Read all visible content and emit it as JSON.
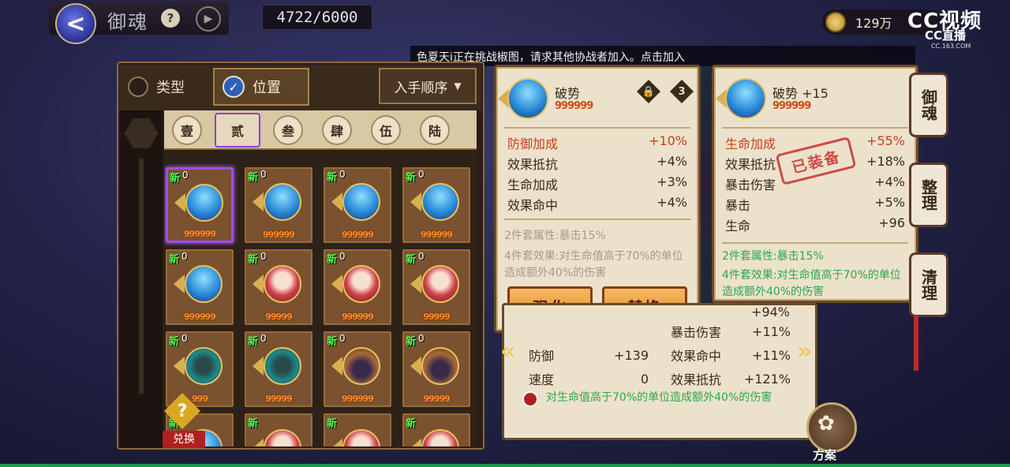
{
  "header": {
    "title": "御魂",
    "help_icon": "?",
    "back_icon": "<",
    "play_icon": "▶",
    "capacity": "4722/6000",
    "currency": "129万",
    "watermark_main": "CC视频",
    "watermark_sub": "CC直播",
    "watermark_url": "CC.163.COM"
  },
  "marquee": "色夏天i正在挑战椒图，请求其他协战者加入。点击加入",
  "filters": {
    "type_label": "类型",
    "position_label": "位置",
    "position_checked": true,
    "sort_label": "入手顺序",
    "sort_caret": "▼"
  },
  "slots": [
    "壹",
    "贰",
    "叁",
    "肆",
    "伍",
    "陆"
  ],
  "active_slot": 1,
  "grid": {
    "new_label": "新",
    "cards": [
      {
        "level": "0",
        "stars": "999999",
        "kind": "blue",
        "selected": true
      },
      {
        "level": "0",
        "stars": "999999",
        "kind": "blue"
      },
      {
        "level": "0",
        "stars": "999999",
        "kind": "blue"
      },
      {
        "level": "0",
        "stars": "999999",
        "kind": "blue"
      },
      {
        "level": "0",
        "stars": "999999",
        "kind": "blue"
      },
      {
        "level": "0",
        "stars": "99999",
        "kind": "red"
      },
      {
        "level": "0",
        "stars": "999999",
        "kind": "red"
      },
      {
        "level": "0",
        "stars": "99999",
        "kind": "red"
      },
      {
        "level": "0",
        "stars": "999",
        "kind": "teal"
      },
      {
        "level": "0",
        "stars": "99999",
        "kind": "teal"
      },
      {
        "level": "0",
        "stars": "999999",
        "kind": "straw"
      },
      {
        "level": "0",
        "stars": "99999",
        "kind": "straw"
      },
      {
        "level": "",
        "stars": "",
        "kind": "blue"
      },
      {
        "level": "",
        "stars": "",
        "kind": "red"
      },
      {
        "level": "",
        "stars": "",
        "kind": "red"
      },
      {
        "level": "",
        "stars": "",
        "kind": "red"
      }
    ]
  },
  "exchange": {
    "icon": "?",
    "label": "兑换"
  },
  "compare_left": {
    "name": "破势",
    "stars": "999999",
    "lock_glyph": "🔒",
    "slot_number": "3",
    "main_stat": {
      "name": "防御加成",
      "value": "+10%"
    },
    "sub_stats": [
      {
        "name": "效果抵抗",
        "value": "+4%"
      },
      {
        "name": "生命加成",
        "value": "+3%"
      },
      {
        "name": "效果命中",
        "value": "+4%"
      }
    ],
    "set2": "2件套属性:暴击15%",
    "set4": "4件套效果:对生命值高于70%的单位造成额外40%的伤害",
    "enhance_button": "强化",
    "replace_button": "替换"
  },
  "compare_right": {
    "name": "破势 +15",
    "stars": "999999",
    "main_stat": {
      "name": "生命加成",
      "value": "+55%"
    },
    "sub_stats": [
      {
        "name": "效果抵抗",
        "value": "+18%"
      },
      {
        "name": "暴击伤害",
        "value": "+4%"
      },
      {
        "name": "暴击",
        "value": "+5%"
      },
      {
        "name": "生命",
        "value": "+96"
      }
    ],
    "set2": "2件套属性:暴击15%",
    "set4": "4件套效果:对生命值高于70%的单位造成额外40%的伤害",
    "stamp": "已装备"
  },
  "summary": {
    "partial_value": "+94%",
    "left_rows": [
      {
        "name": "防御",
        "value": "+139"
      },
      {
        "name": "速度",
        "value": "0"
      }
    ],
    "right_rows": [
      {
        "name": "暴击伤害",
        "value": "+11%"
      },
      {
        "name": "效果命中",
        "value": "+11%"
      },
      {
        "name": "效果抵抗",
        "value": "+121%"
      }
    ],
    "effect": "对生命值高于70%的单位造成额外40%的伤害",
    "nav_left": "«",
    "nav_right": "»"
  },
  "side_tabs": [
    "御魂",
    "整理",
    "清理"
  ],
  "plan": {
    "label": "方案",
    "glyph": "✿"
  },
  "colors": {
    "main_stat": "#c8401a",
    "set_active": "#2aa84a",
    "stars": "#ff8a2a",
    "selected_border": "#9b4dff"
  }
}
